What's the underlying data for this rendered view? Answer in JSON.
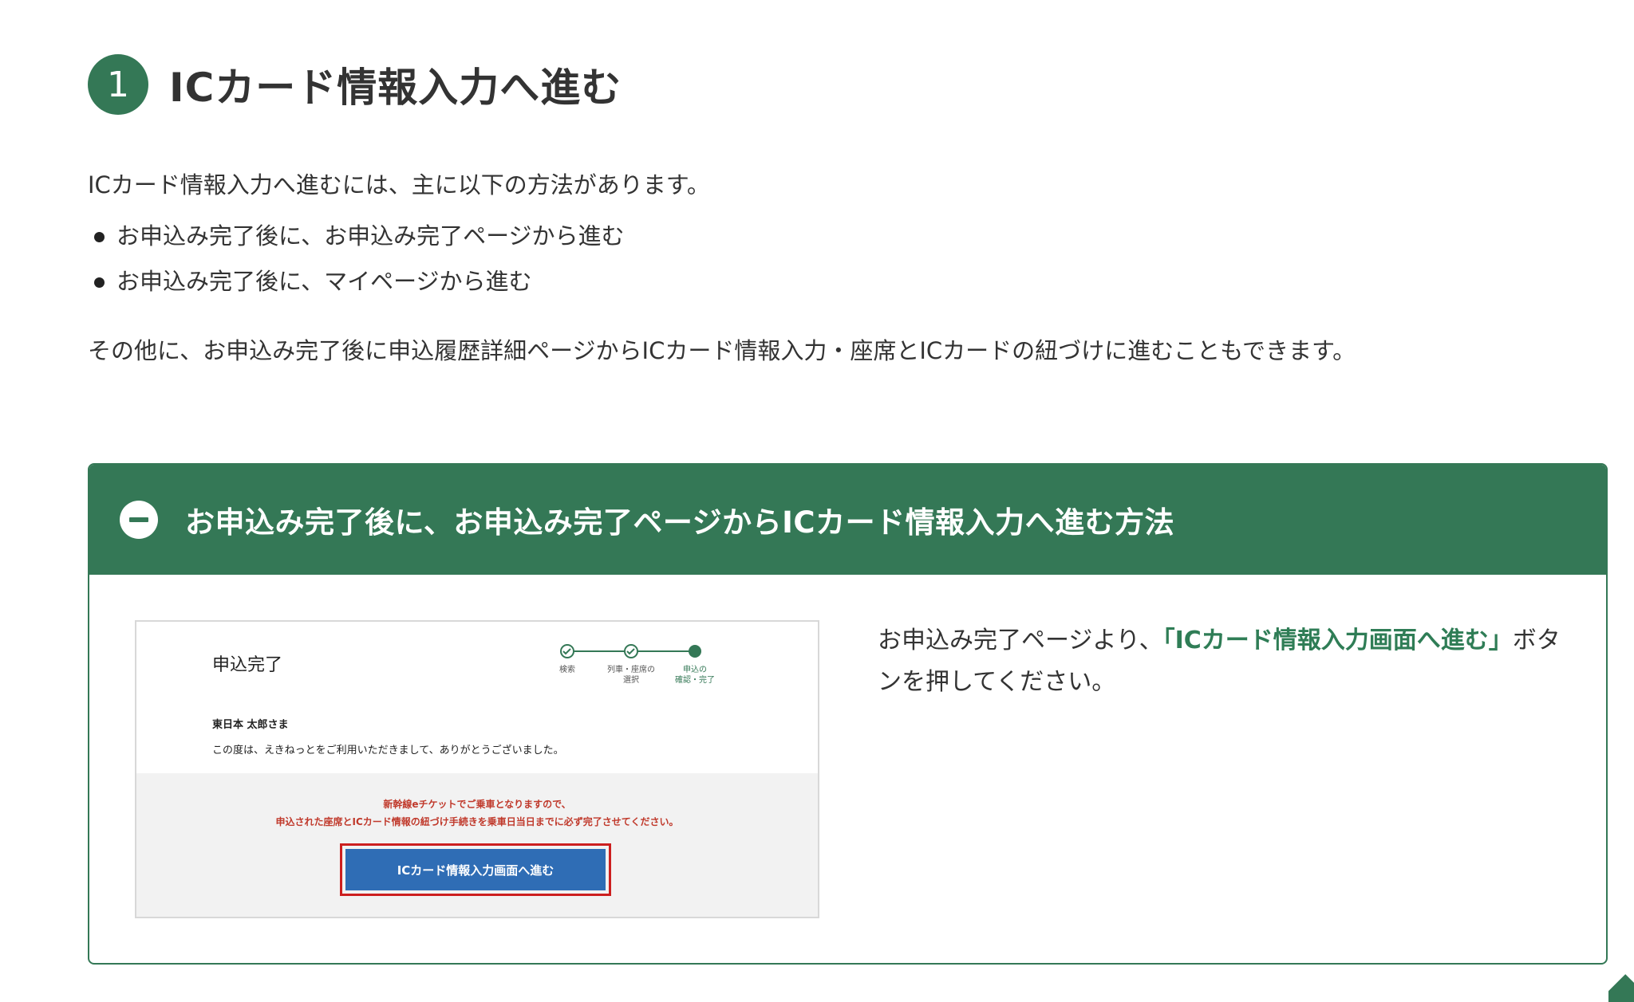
{
  "step": {
    "number": "1",
    "title": "ICカード情報入力へ進む"
  },
  "intro": "ICカード情報入力へ進むには、主に以下の方法があります。",
  "methods": [
    "お申込み完了後に、お申込み完了ページから進む",
    "お申込み完了後に、マイページから進む"
  ],
  "other_note": "その他に、お申込み完了後に申込履歴詳細ページからICカード情報入力・座席とICカードの紐づけに進むこともできます。",
  "accordion": {
    "title": "お申込み完了後に、お申込み完了ページからICカード情報入力へ進む方法",
    "toggle_icon": "minus-icon",
    "description_before": "お申込み完了ページより、",
    "description_link": "「ICカード情報入力画面へ進む」",
    "description_after": "ボタンを押してください。"
  },
  "mock_screen": {
    "title": "申込完了",
    "steps": [
      "検索",
      "列車・座席の\n選択",
      "申込の\n確認・完了"
    ],
    "customer_name": "東日本 太郎さま",
    "thanks": "この度は、えきねっとをご利用いただきまして、ありがとうございました。",
    "notice_line1": "新幹線eチケットでご乗車となりますので、",
    "notice_line2": "申込された座席とICカード情報の紐づけ手続きを乗車日当日までに必ず完了させてください。",
    "button_label": "ICカード情報入力画面へ進む"
  },
  "colors": {
    "brand_green": "#347856",
    "link_green": "#2f7d56",
    "mock_button_blue": "#2f6db5",
    "highlight_red": "#cc1f1f",
    "notice_red": "#c0392b"
  }
}
